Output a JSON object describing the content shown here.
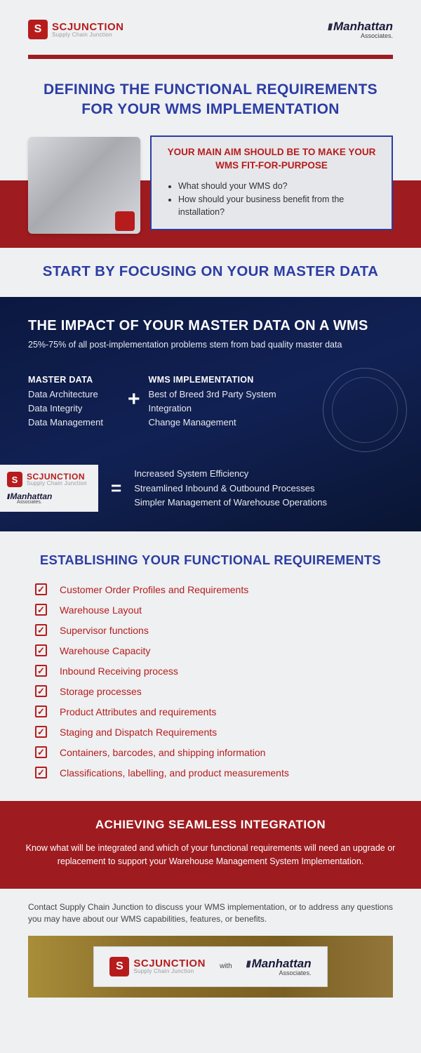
{
  "brand": {
    "scj_mark": "S",
    "scj_name": "SCJUNCTION",
    "scj_tag": "Supply Chain Junction",
    "man_name": "Manhattan",
    "man_tag": "Associates."
  },
  "title": "DEFINING THE FUNCTIONAL REQUIREMENTS FOR YOUR WMS IMPLEMENTATION",
  "aim": {
    "heading": "YOUR MAIN AIM SHOULD BE TO MAKE YOUR WMS FIT-FOR-PURPOSE",
    "bullets": [
      "What should your WMS do?",
      "How should your business benefit from the installation?"
    ]
  },
  "focus_heading": "START BY FOCUSING ON YOUR MASTER DATA",
  "impact": {
    "title": "THE IMPACT OF YOUR MASTER DATA ON A WMS",
    "stat": "25%-75% of all post-implementation problems stem from bad quality master data",
    "col1_h": "MASTER DATA",
    "col1_body": "Data Architecture\nData Integrity\nData Management",
    "col2_h": "WMS IMPLEMENTATION",
    "col2_body": "Best of Breed 3rd Party System\nIntegration\nChange Management",
    "results": "Increased System Efficiency\nStreamlined Inbound & Outbound Processes\nSimpler Management of Warehouse Operations"
  },
  "establish_heading": "ESTABLISHING YOUR FUNCTIONAL REQUIREMENTS",
  "requirements": [
    "Customer Order Profiles and Requirements",
    "Warehouse Layout",
    "Supervisor functions",
    "Warehouse Capacity",
    "Inbound Receiving process",
    "Storage processes",
    "Product Attributes and requirements",
    "Staging and Dispatch Requirements",
    "Containers, barcodes, and shipping information",
    "Classifications, labelling, and product measurements"
  ],
  "integration": {
    "title": "ACHIEVING SEAMLESS INTEGRATION",
    "body": "Know what will be integrated and which of your functional requirements will need an upgrade or replacement to support your Warehouse Management System Implementation."
  },
  "contact": "Contact Supply Chain Junction to discuss your WMS implementation, or to address any questions you may have about our WMS capabilities, features, or benefits.",
  "footer_with": "with"
}
